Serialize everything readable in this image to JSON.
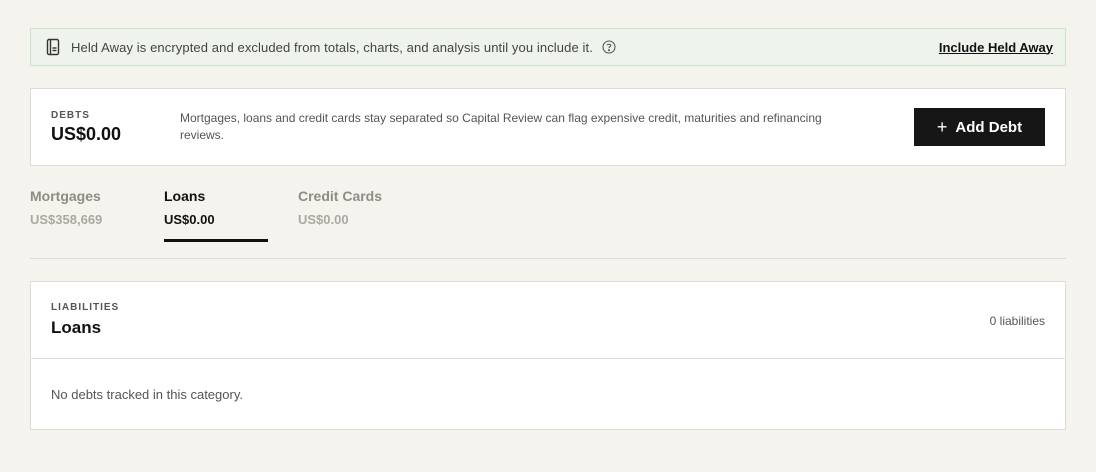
{
  "banner": {
    "icon": "ledger-icon",
    "text": "Held Away is encrypted and excluded from totals, charts, and analysis until you include it.",
    "help_icon": "help-circle-icon",
    "link_label": "Include Held Away"
  },
  "debts": {
    "eyebrow": "DEBTS",
    "total": "US$0.00",
    "description": "Mortgages, loans and credit cards stay separated so Capital Review can flag expensive credit, maturities and refinancing reviews.",
    "add_button": {
      "icon": "plus-icon",
      "label": "Add Debt"
    }
  },
  "tabs": [
    {
      "label": "Mortgages",
      "value": "US$358,669",
      "active": false
    },
    {
      "label": "Loans",
      "value": "US$0.00",
      "active": true
    },
    {
      "label": "Credit Cards",
      "value": "US$0.00",
      "active": false
    }
  ],
  "liabilities": {
    "eyebrow": "LIABILITIES",
    "title": "Loans",
    "count": "0 liabilities",
    "empty_text": "No debts tracked in this category."
  },
  "colors": {
    "background": "#f4f3ee",
    "banner_bg": "#eef4ec",
    "primary_button": "#161616",
    "inactive_tab": "#8d8d86"
  }
}
